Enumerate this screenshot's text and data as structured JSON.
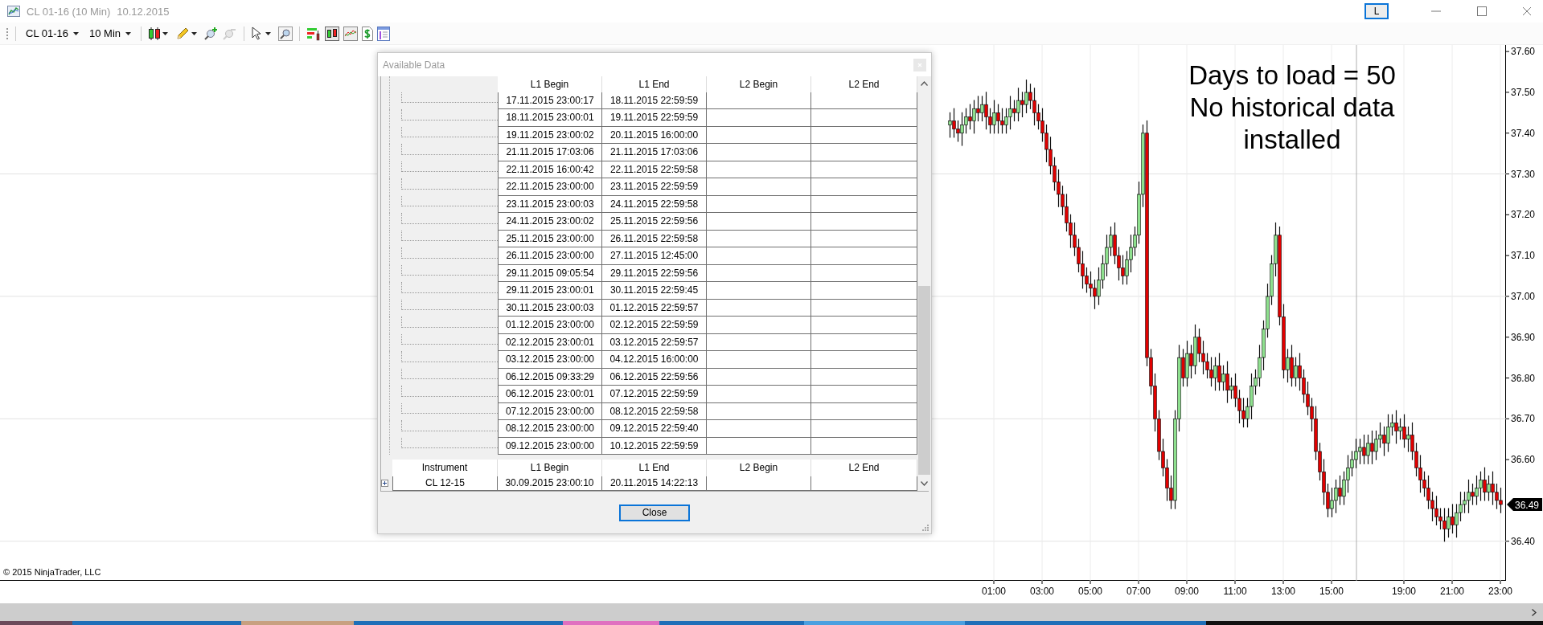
{
  "window": {
    "title": "CL 01-16 (10 Min)",
    "date": "10.12.2015",
    "layout_button": "L"
  },
  "toolbar": {
    "instrument": "CL 01-16",
    "interval": "10 Min"
  },
  "chart": {
    "annotation": [
      "Days to load = 50",
      "No historical data",
      "installed"
    ],
    "copyright": "© 2015 NinjaTrader, LLC",
    "last_price": "36.49",
    "chart_data": {
      "type": "candlestick",
      "categories": [
        null,
        null,
        null,
        null,
        null,
        null,
        null,
        null,
        null,
        null,
        null,
        "01:00",
        null,
        null,
        null,
        null,
        null,
        null,
        null,
        null,
        null,
        null,
        null,
        "03:00",
        null,
        null,
        null,
        null,
        null,
        null,
        null,
        null,
        null,
        null,
        null,
        "05:00",
        null,
        null,
        null,
        null,
        null,
        null,
        null,
        null,
        null,
        null,
        null,
        "07:00",
        null,
        null,
        null,
        null,
        null,
        null,
        null,
        null,
        null,
        null,
        null,
        "09:00",
        null,
        null,
        null,
        null,
        null,
        null,
        null,
        null,
        null,
        null,
        null,
        "11:00",
        null,
        null,
        null,
        null,
        null,
        null,
        null,
        null,
        null,
        null,
        null,
        "13:00",
        null,
        null,
        null,
        null,
        null,
        null,
        null,
        null,
        null,
        null,
        null,
        "15:00",
        null,
        null,
        null,
        null,
        null,
        null,
        null,
        null,
        null,
        null,
        null,
        null,
        null,
        null,
        null,
        null,
        null,
        "19:00",
        null,
        null,
        null,
        null,
        null,
        null,
        null,
        null,
        null,
        null,
        null,
        "21:00",
        null,
        null,
        null,
        null,
        null,
        null,
        null,
        null,
        null,
        null,
        null,
        "23:00"
      ],
      "ohlc": [
        [
          37.42,
          37.45,
          37.39,
          37.43
        ],
        [
          37.43,
          37.46,
          37.39,
          37.41
        ],
        [
          37.41,
          37.43,
          37.38,
          37.4
        ],
        [
          37.4,
          37.45,
          37.37,
          37.42
        ],
        [
          37.42,
          37.46,
          37.4,
          37.44
        ],
        [
          37.44,
          37.47,
          37.41,
          37.43
        ],
        [
          37.43,
          37.48,
          37.4,
          37.46
        ],
        [
          37.46,
          37.49,
          37.43,
          37.45
        ],
        [
          37.45,
          37.49,
          37.43,
          37.47
        ],
        [
          37.47,
          37.5,
          37.41,
          37.44
        ],
        [
          37.44,
          37.46,
          37.4,
          37.42
        ],
        [
          37.42,
          37.48,
          37.4,
          37.45
        ],
        [
          37.45,
          37.47,
          37.4,
          37.43
        ],
        [
          37.43,
          37.46,
          37.4,
          37.42
        ],
        [
          37.42,
          37.46,
          37.4,
          37.44
        ],
        [
          37.44,
          37.49,
          37.41,
          37.46
        ],
        [
          37.46,
          37.48,
          37.43,
          37.45
        ],
        [
          37.45,
          37.51,
          37.43,
          37.48
        ],
        [
          37.48,
          37.5,
          37.44,
          37.47
        ],
        [
          37.47,
          37.53,
          37.45,
          37.5
        ],
        [
          37.5,
          37.52,
          37.46,
          37.48
        ],
        [
          37.48,
          37.51,
          37.42,
          37.45
        ],
        [
          37.45,
          37.47,
          37.41,
          37.43
        ],
        [
          37.43,
          37.46,
          37.38,
          37.4
        ],
        [
          37.4,
          37.42,
          37.33,
          37.36
        ],
        [
          37.36,
          37.39,
          37.3,
          37.32
        ],
        [
          37.32,
          37.34,
          37.26,
          37.28
        ],
        [
          37.28,
          37.31,
          37.22,
          37.25
        ],
        [
          37.25,
          37.27,
          37.2,
          37.22
        ],
        [
          37.22,
          37.25,
          37.16,
          37.18
        ],
        [
          37.18,
          37.2,
          37.12,
          37.15
        ],
        [
          37.15,
          37.18,
          37.1,
          37.12
        ],
        [
          37.12,
          37.14,
          37.06,
          37.08
        ],
        [
          37.08,
          37.11,
          37.02,
          37.05
        ],
        [
          37.05,
          37.07,
          37.01,
          37.03
        ],
        [
          37.03,
          37.06,
          37.0,
          37.02
        ],
        [
          37.02,
          37.04,
          36.97,
          37.0
        ],
        [
          37.0,
          37.07,
          36.98,
          37.04
        ],
        [
          37.04,
          37.1,
          37.02,
          37.08
        ],
        [
          37.08,
          37.15,
          37.05,
          37.12
        ],
        [
          37.12,
          37.17,
          37.1,
          37.15
        ],
        [
          37.15,
          37.18,
          37.08,
          37.1
        ],
        [
          37.1,
          37.12,
          37.04,
          37.07
        ],
        [
          37.07,
          37.1,
          37.03,
          37.05
        ],
        [
          37.05,
          37.11,
          37.03,
          37.09
        ],
        [
          37.09,
          37.15,
          37.06,
          37.12
        ],
        [
          37.12,
          37.17,
          37.1,
          37.15
        ],
        [
          37.15,
          37.28,
          37.13,
          37.25
        ],
        [
          37.25,
          37.42,
          37.22,
          37.4
        ],
        [
          37.4,
          37.43,
          36.83,
          36.85
        ],
        [
          36.85,
          36.87,
          36.76,
          36.78
        ],
        [
          36.78,
          36.81,
          36.67,
          36.7
        ],
        [
          36.7,
          36.72,
          36.6,
          36.62
        ],
        [
          36.62,
          36.65,
          36.56,
          36.58
        ],
        [
          36.58,
          36.6,
          36.5,
          36.53
        ],
        [
          36.53,
          36.56,
          36.48,
          36.5
        ],
        [
          36.5,
          36.72,
          36.48,
          36.7
        ],
        [
          36.7,
          36.88,
          36.67,
          36.85
        ],
        [
          36.85,
          36.87,
          36.78,
          36.8
        ],
        [
          36.8,
          36.89,
          36.78,
          36.86
        ],
        [
          36.86,
          36.88,
          36.8,
          36.83
        ],
        [
          36.83,
          36.93,
          36.81,
          36.9
        ],
        [
          36.9,
          36.92,
          36.84,
          36.86
        ],
        [
          36.86,
          36.89,
          36.81,
          36.84
        ],
        [
          36.84,
          36.86,
          36.8,
          36.82
        ],
        [
          36.82,
          36.85,
          36.78,
          36.8
        ],
        [
          36.8,
          36.85,
          36.77,
          36.83
        ],
        [
          36.83,
          36.86,
          36.77,
          36.79
        ],
        [
          36.79,
          36.83,
          36.77,
          36.81
        ],
        [
          36.81,
          36.84,
          36.74,
          36.77
        ],
        [
          36.77,
          36.8,
          36.75,
          36.78
        ],
        [
          36.78,
          36.81,
          36.73,
          36.75
        ],
        [
          36.75,
          36.77,
          36.69,
          36.72
        ],
        [
          36.72,
          36.75,
          36.68,
          36.7
        ],
        [
          36.7,
          36.75,
          36.68,
          36.73
        ],
        [
          36.73,
          36.81,
          36.7,
          36.78
        ],
        [
          36.78,
          36.82,
          36.76,
          36.8
        ],
        [
          36.8,
          36.88,
          36.78,
          36.85
        ],
        [
          36.85,
          36.94,
          36.82,
          36.92
        ],
        [
          36.92,
          37.03,
          36.9,
          37.0
        ],
        [
          37.0,
          37.1,
          36.98,
          37.08
        ],
        [
          37.08,
          37.18,
          37.05,
          37.15
        ],
        [
          37.15,
          37.17,
          36.93,
          36.95
        ],
        [
          36.95,
          36.98,
          36.8,
          36.82
        ],
        [
          36.82,
          36.87,
          36.79,
          36.85
        ],
        [
          36.85,
          36.88,
          36.78,
          36.8
        ],
        [
          36.8,
          36.85,
          36.78,
          36.83
        ],
        [
          36.83,
          36.86,
          36.77,
          36.8
        ],
        [
          36.8,
          36.82,
          36.74,
          36.76
        ],
        [
          36.76,
          36.79,
          36.71,
          36.73
        ],
        [
          36.73,
          36.75,
          36.67,
          36.7
        ],
        [
          36.7,
          36.73,
          36.6,
          36.62
        ],
        [
          36.62,
          36.64,
          36.55,
          36.57
        ],
        [
          36.57,
          36.6,
          36.49,
          36.52
        ],
        [
          36.52,
          36.54,
          36.46,
          36.48
        ],
        [
          36.48,
          36.53,
          36.46,
          36.5
        ],
        [
          36.5,
          36.55,
          36.47,
          36.53
        ],
        [
          36.53,
          36.56,
          36.49,
          36.51
        ],
        [
          36.51,
          36.57,
          36.49,
          36.55
        ],
        [
          36.55,
          36.61,
          36.52,
          36.58
        ],
        [
          36.58,
          36.62,
          36.56,
          36.6
        ],
        [
          36.6,
          36.65,
          36.58,
          36.62
        ],
        [
          36.62,
          36.65,
          36.59,
          36.63
        ],
        [
          36.63,
          36.66,
          36.59,
          36.61
        ],
        [
          36.61,
          36.66,
          36.59,
          36.64
        ],
        [
          36.64,
          36.67,
          36.59,
          36.62
        ],
        [
          36.62,
          36.67,
          36.6,
          36.65
        ],
        [
          36.65,
          36.69,
          36.63,
          36.66
        ],
        [
          36.66,
          36.68,
          36.61,
          36.64
        ],
        [
          36.64,
          36.71,
          36.62,
          36.68
        ],
        [
          36.68,
          36.71,
          36.66,
          36.69
        ],
        [
          36.69,
          36.72,
          36.64,
          36.67
        ],
        [
          36.67,
          36.7,
          36.65,
          36.68
        ],
        [
          36.68,
          36.71,
          36.63,
          36.65
        ],
        [
          36.65,
          36.68,
          36.62,
          36.66
        ],
        [
          36.66,
          36.69,
          36.6,
          36.62
        ],
        [
          36.62,
          36.64,
          36.56,
          36.58
        ],
        [
          36.58,
          36.61,
          36.52,
          36.55
        ],
        [
          36.55,
          36.57,
          36.51,
          36.53
        ],
        [
          36.53,
          36.56,
          36.48,
          36.5
        ],
        [
          36.5,
          36.52,
          36.45,
          36.48
        ],
        [
          36.48,
          36.51,
          36.44,
          36.46
        ],
        [
          36.46,
          36.48,
          36.43,
          36.45
        ],
        [
          36.45,
          36.48,
          36.4,
          36.43
        ],
        [
          36.43,
          36.48,
          36.41,
          36.46
        ],
        [
          36.46,
          36.49,
          36.42,
          36.44
        ],
        [
          36.44,
          36.49,
          36.41,
          36.47
        ],
        [
          36.47,
          36.52,
          36.45,
          36.49
        ],
        [
          36.49,
          36.52,
          36.47,
          36.5
        ],
        [
          36.5,
          36.55,
          36.47,
          36.52
        ],
        [
          36.52,
          36.54,
          36.49,
          36.51
        ],
        [
          36.51,
          36.56,
          36.49,
          36.53
        ],
        [
          36.53,
          36.57,
          36.5,
          36.55
        ],
        [
          36.55,
          36.58,
          36.5,
          36.52
        ],
        [
          36.52,
          36.56,
          36.5,
          36.54
        ],
        [
          36.54,
          36.57,
          36.49,
          36.52
        ],
        [
          36.52,
          36.54,
          36.48,
          36.5
        ],
        [
          36.5,
          36.53,
          36.47,
          36.49
        ]
      ],
      "grid": true,
      "ylim": [
        36.303,
        37.616
      ],
      "yticks": [
        {
          "value": 37.6,
          "label": "37.60"
        },
        {
          "value": 37.5,
          "label": "37.50"
        },
        {
          "value": 37.4,
          "label": "37.40"
        },
        {
          "value": 37.3,
          "label": "37.30"
        },
        {
          "value": 37.2,
          "label": "37.20"
        },
        {
          "value": 37.1,
          "label": "37.10"
        },
        {
          "value": 37.0,
          "label": "37.00"
        },
        {
          "value": 36.9,
          "label": "36.90"
        },
        {
          "value": 36.8,
          "label": "36.80"
        },
        {
          "value": 36.7,
          "label": "36.70"
        },
        {
          "value": 36.6,
          "label": "36.60"
        },
        {
          "value": 36.4,
          "label": "36.40"
        }
      ]
    }
  },
  "dialog": {
    "title": "Available Data",
    "child_columns": [
      "L1 Begin",
      "L1 End",
      "L2 Begin",
      "L2 End"
    ],
    "child_rows": [
      {
        "l1_begin": "17.11.2015 23:00:17",
        "l1_end": "18.11.2015 22:59:59"
      },
      {
        "l1_begin": "18.11.2015 23:00:01",
        "l1_end": "19.11.2015 22:59:59"
      },
      {
        "l1_begin": "19.11.2015 23:00:02",
        "l1_end": "20.11.2015 16:00:00"
      },
      {
        "l1_begin": "21.11.2015 17:03:06",
        "l1_end": "21.11.2015 17:03:06"
      },
      {
        "l1_begin": "22.11.2015 16:00:42",
        "l1_end": "22.11.2015 22:59:58"
      },
      {
        "l1_begin": "22.11.2015 23:00:00",
        "l1_end": "23.11.2015 22:59:59"
      },
      {
        "l1_begin": "23.11.2015 23:00:03",
        "l1_end": "24.11.2015 22:59:58"
      },
      {
        "l1_begin": "24.11.2015 23:00:02",
        "l1_end": "25.11.2015 22:59:56"
      },
      {
        "l1_begin": "25.11.2015 23:00:00",
        "l1_end": "26.11.2015 22:59:58"
      },
      {
        "l1_begin": "26.11.2015 23:00:00",
        "l1_end": "27.11.2015 12:45:00"
      },
      {
        "l1_begin": "29.11.2015 09:05:54",
        "l1_end": "29.11.2015 22:59:56"
      },
      {
        "l1_begin": "29.11.2015 23:00:01",
        "l1_end": "30.11.2015 22:59:45"
      },
      {
        "l1_begin": "30.11.2015 23:00:03",
        "l1_end": "01.12.2015 22:59:57"
      },
      {
        "l1_begin": "01.12.2015 23:00:00",
        "l1_end": "02.12.2015 22:59:59"
      },
      {
        "l1_begin": "02.12.2015 23:00:01",
        "l1_end": "03.12.2015 22:59:57"
      },
      {
        "l1_begin": "03.12.2015 23:00:00",
        "l1_end": "04.12.2015 16:00:00"
      },
      {
        "l1_begin": "06.12.2015 09:33:29",
        "l1_end": "06.12.2015 22:59:56"
      },
      {
        "l1_begin": "06.12.2015 23:00:01",
        "l1_end": "07.12.2015 22:59:59"
      },
      {
        "l1_begin": "07.12.2015 23:00:00",
        "l1_end": "08.12.2015 22:59:58"
      },
      {
        "l1_begin": "08.12.2015 23:00:00",
        "l1_end": "09.12.2015 22:59:40"
      },
      {
        "l1_begin": "09.12.2015 23:00:00",
        "l1_end": "10.12.2015 22:59:59"
      }
    ],
    "parent_columns": [
      "Instrument",
      "L1 Begin",
      "L1 End",
      "L2 Begin",
      "L2 End"
    ],
    "parent_rows": [
      {
        "instrument": "CL 12-15",
        "l1_begin": "30.09.2015 23:00:10",
        "l1_end": "20.11.2015 14:22:13",
        "expanded": false
      }
    ],
    "close_button": "Close"
  }
}
